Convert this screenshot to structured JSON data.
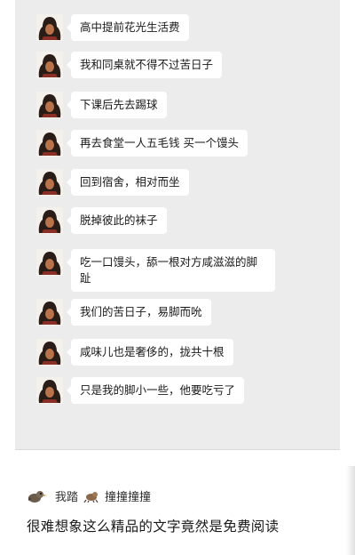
{
  "messages": [
    {
      "text": "高中提前花光生活费",
      "icon": "hooded-figure-avatar-icon"
    },
    {
      "text": "我和同桌就不得不过苦日子",
      "icon": "hooded-figure-avatar-icon"
    },
    {
      "text": "下课后先去踢球",
      "icon": "hooded-figure-avatar-icon"
    },
    {
      "text": "再去食堂一人五毛钱 买一个馒头",
      "icon": "hooded-figure-avatar-icon"
    },
    {
      "text": "回到宿舍，相对而坐",
      "icon": "hooded-figure-avatar-icon"
    },
    {
      "text": "脱掉彼此的袜子",
      "icon": "hooded-figure-avatar-icon"
    },
    {
      "text": "吃一口馒头，舔一根对方咸滋滋的脚趾",
      "icon": "hooded-figure-avatar-icon"
    },
    {
      "text": "我们的苦日子，易脚而吮",
      "icon": "hooded-figure-avatar-icon"
    },
    {
      "text": "咸味儿也是奢侈的，拢共十根",
      "icon": "hooded-figure-avatar-icon"
    },
    {
      "text": "只是我的脚小一些，他要吃亏了",
      "icon": "hooded-figure-avatar-icon"
    }
  ],
  "comment": {
    "username": "我踏",
    "reaction": "撞撞撞撞",
    "body": "很难想象这么精品的文字竟然是免费阅读"
  },
  "colors": {
    "chat_background": "#ececec",
    "bubble": "#ffffff",
    "page_background": "#ffffff",
    "text": "#1a1a1a"
  }
}
